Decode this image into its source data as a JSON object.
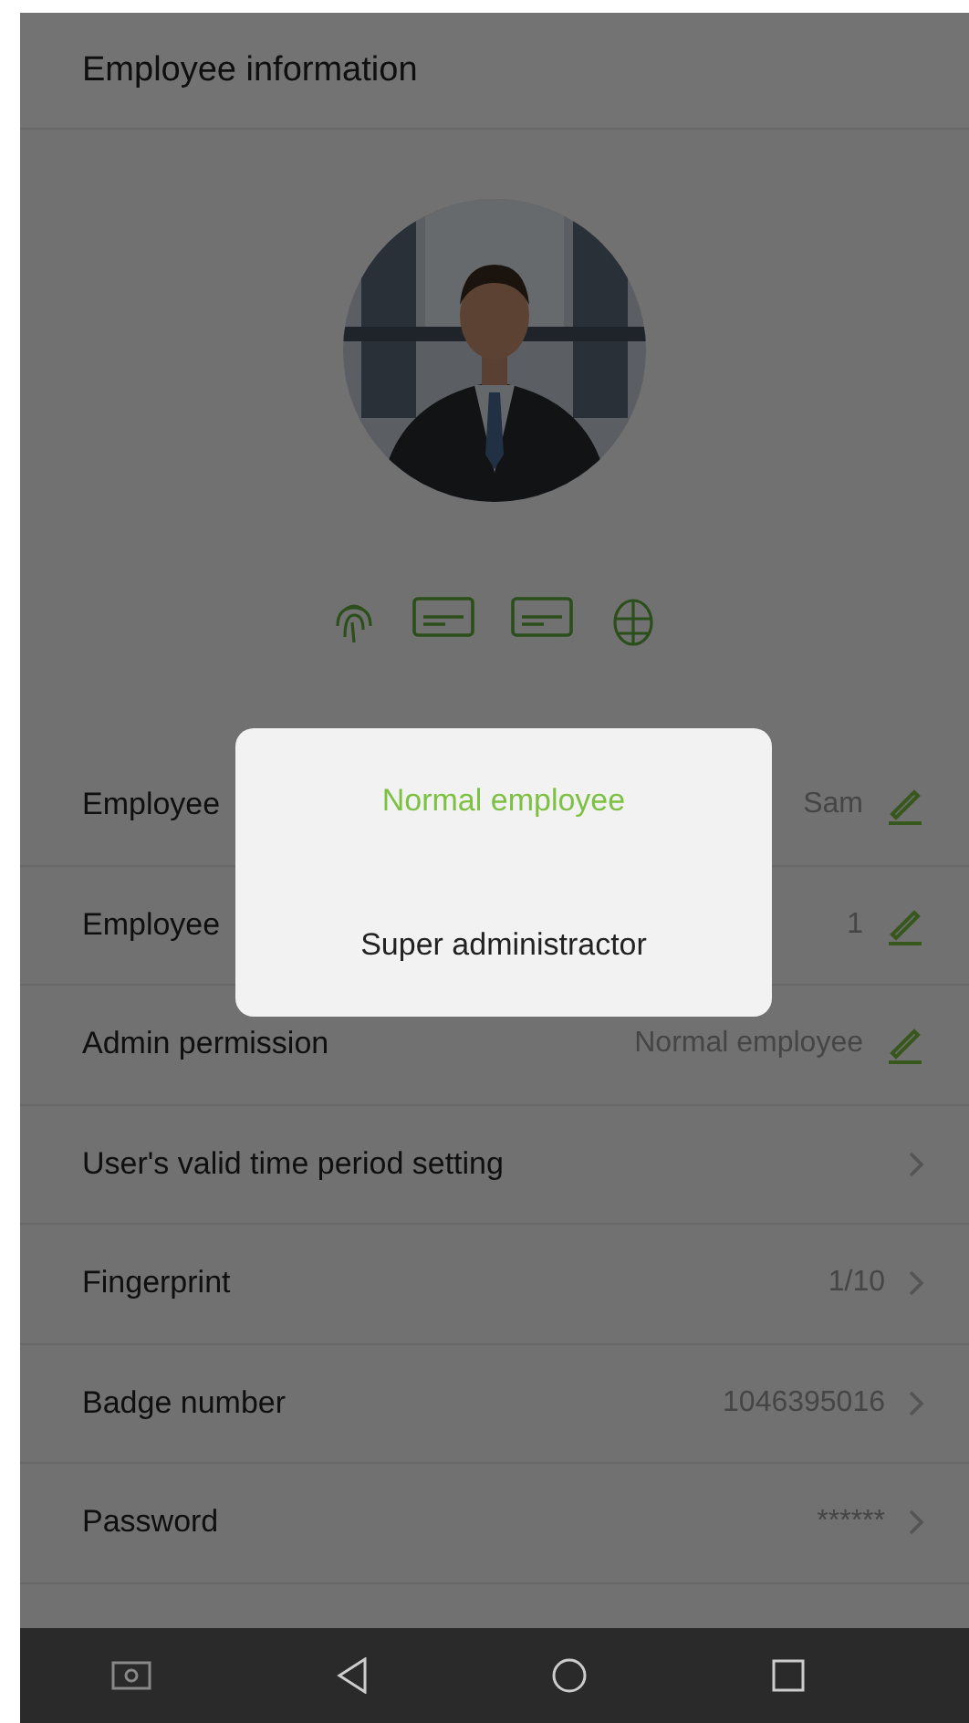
{
  "header": {
    "title": "Employee information"
  },
  "rows": [
    {
      "label": "Employee",
      "value": "Sam",
      "kind": "edit"
    },
    {
      "label": "Employee",
      "value": "1",
      "kind": "edit"
    },
    {
      "label": "Admin permission",
      "value": "Normal employee",
      "kind": "edit"
    },
    {
      "label": "User's valid time period setting",
      "kind": "arrow"
    },
    {
      "label": "Fingerprint",
      "value": "1/10",
      "kind": "arrow"
    },
    {
      "label": "Badge number",
      "value": "1046395016",
      "kind": "arrow"
    },
    {
      "label": "Password",
      "value": "******",
      "kind": "arrow"
    }
  ],
  "dialog": {
    "options": [
      {
        "label": "Normal employee",
        "selected": true
      },
      {
        "label": "Super administractor",
        "selected": false
      }
    ]
  }
}
